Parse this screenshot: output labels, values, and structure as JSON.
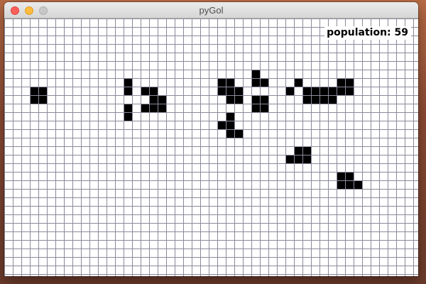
{
  "window": {
    "title": "pyGol"
  },
  "overlay": {
    "population_text": "population: 59"
  },
  "board": {
    "cell_fill": "#000000",
    "grid_line": "#8a8a9a",
    "background": "#ffffff",
    "live_cells": [
      [
        3,
        8
      ],
      [
        4,
        8
      ],
      [
        3,
        9
      ],
      [
        4,
        9
      ],
      [
        14,
        7
      ],
      [
        14,
        8
      ],
      [
        16,
        8
      ],
      [
        17,
        8
      ],
      [
        17,
        9
      ],
      [
        18,
        9
      ],
      [
        17,
        10
      ],
      [
        18,
        10
      ],
      [
        16,
        10
      ],
      [
        14,
        10
      ],
      [
        14,
        11
      ],
      [
        25,
        7
      ],
      [
        26,
        7
      ],
      [
        25,
        8
      ],
      [
        26,
        8
      ],
      [
        27,
        8
      ],
      [
        26,
        9
      ],
      [
        27,
        9
      ],
      [
        26,
        11
      ],
      [
        25,
        12
      ],
      [
        26,
        12
      ],
      [
        26,
        13
      ],
      [
        27,
        13
      ],
      [
        29,
        6
      ],
      [
        29,
        7
      ],
      [
        30,
        7
      ],
      [
        29,
        9
      ],
      [
        30,
        9
      ],
      [
        29,
        10
      ],
      [
        30,
        10
      ],
      [
        33,
        8
      ],
      [
        34,
        7
      ],
      [
        35,
        8
      ],
      [
        36,
        8
      ],
      [
        37,
        8
      ],
      [
        38,
        8
      ],
      [
        39,
        8
      ],
      [
        39,
        7
      ],
      [
        40,
        7
      ],
      [
        40,
        8
      ],
      [
        35,
        9
      ],
      [
        36,
        9
      ],
      [
        37,
        9
      ],
      [
        38,
        9
      ],
      [
        34,
        15
      ],
      [
        34,
        16
      ],
      [
        33,
        16
      ],
      [
        35,
        16
      ],
      [
        35,
        15
      ],
      [
        39,
        19
      ],
      [
        40,
        19
      ],
      [
        39,
        18
      ],
      [
        40,
        18
      ],
      [
        41,
        19
      ]
    ]
  }
}
